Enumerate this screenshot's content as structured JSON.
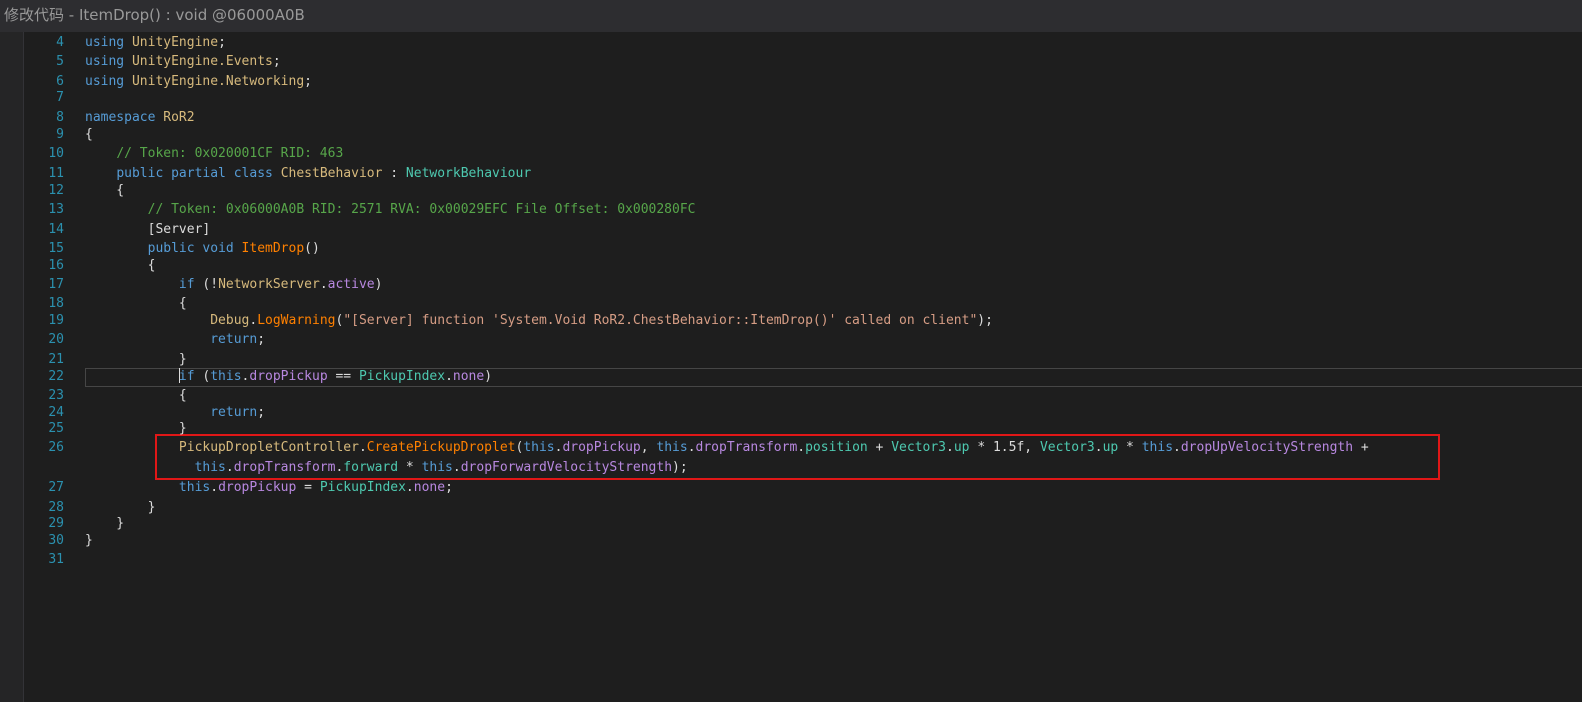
{
  "window": {
    "title": "修改代码 - ItemDrop() : void @06000A0B"
  },
  "colors": {
    "keyword": "#569cd6",
    "namespace": "#d7ba7d",
    "type": "#4ec9b0",
    "method": "#ff8000",
    "field": "#b888e0",
    "property": "#4ec9b0",
    "comment": "#57a64a",
    "string": "#d69d85",
    "line_number": "#2b91af",
    "plain": "#dcdcdc",
    "title_text": "#999999"
  },
  "code_lines": [
    {
      "num": "4",
      "tokens": [
        {
          "t": "using ",
          "c": "keyword"
        },
        {
          "t": "UnityEngine",
          "c": "namespace"
        },
        {
          "t": ";",
          "c": "plain"
        }
      ]
    },
    {
      "num": "5",
      "tokens": [
        {
          "t": "using ",
          "c": "keyword"
        },
        {
          "t": "UnityEngine.Events",
          "c": "namespace"
        },
        {
          "t": ";",
          "c": "plain"
        }
      ]
    },
    {
      "num": "6",
      "tokens": [
        {
          "t": "using ",
          "c": "keyword"
        },
        {
          "t": "UnityEngine.Networking",
          "c": "namespace"
        },
        {
          "t": ";",
          "c": "plain"
        }
      ]
    },
    {
      "num": "7",
      "tokens": []
    },
    {
      "num": "8",
      "tokens": [
        {
          "t": "namespace ",
          "c": "keyword"
        },
        {
          "t": "RoR2",
          "c": "namespace"
        }
      ]
    },
    {
      "num": "9",
      "tokens": [
        {
          "t": "{",
          "c": "plain"
        }
      ]
    },
    {
      "num": "10",
      "tokens": [
        {
          "t": "    ",
          "c": "plain"
        },
        {
          "t": "// Token: 0x020001CF RID: 463",
          "c": "comment"
        }
      ]
    },
    {
      "num": "11",
      "tokens": [
        {
          "t": "    ",
          "c": "plain"
        },
        {
          "t": "public partial class ",
          "c": "keyword"
        },
        {
          "t": "ChestBehavior",
          "c": "namespace"
        },
        {
          "t": " : ",
          "c": "plain"
        },
        {
          "t": "NetworkBehaviour",
          "c": "type"
        }
      ]
    },
    {
      "num": "12",
      "tokens": [
        {
          "t": "    {",
          "c": "plain"
        }
      ]
    },
    {
      "num": "13",
      "tokens": [
        {
          "t": "        ",
          "c": "plain"
        },
        {
          "t": "// Token: 0x06000A0B RID: 2571 RVA: 0x00029EFC File Offset: 0x000280FC",
          "c": "comment"
        }
      ]
    },
    {
      "num": "14",
      "tokens": [
        {
          "t": "        [",
          "c": "plain"
        },
        {
          "t": "Server",
          "c": "plain"
        },
        {
          "t": "]",
          "c": "plain"
        }
      ]
    },
    {
      "num": "15",
      "tokens": [
        {
          "t": "        ",
          "c": "plain"
        },
        {
          "t": "public void ",
          "c": "keyword"
        },
        {
          "t": "ItemDrop",
          "c": "method"
        },
        {
          "t": "()",
          "c": "plain"
        }
      ]
    },
    {
      "num": "16",
      "tokens": [
        {
          "t": "        {",
          "c": "plain"
        }
      ]
    },
    {
      "num": "17",
      "tokens": [
        {
          "t": "            ",
          "c": "plain"
        },
        {
          "t": "if",
          "c": "keyword"
        },
        {
          "t": " (!",
          "c": "plain"
        },
        {
          "t": "NetworkServer",
          "c": "namespace"
        },
        {
          "t": ".",
          "c": "plain"
        },
        {
          "t": "active",
          "c": "field"
        },
        {
          "t": ")",
          "c": "plain"
        }
      ]
    },
    {
      "num": "18",
      "tokens": [
        {
          "t": "            {",
          "c": "plain"
        }
      ]
    },
    {
      "num": "19",
      "tokens": [
        {
          "t": "                ",
          "c": "plain"
        },
        {
          "t": "Debug",
          "c": "namespace"
        },
        {
          "t": ".",
          "c": "plain"
        },
        {
          "t": "LogWarning",
          "c": "method"
        },
        {
          "t": "(",
          "c": "plain"
        },
        {
          "t": "\"[Server] function 'System.Void RoR2.ChestBehavior::ItemDrop()' called on client\"",
          "c": "string"
        },
        {
          "t": ");",
          "c": "plain"
        }
      ]
    },
    {
      "num": "20",
      "tokens": [
        {
          "t": "                ",
          "c": "plain"
        },
        {
          "t": "return",
          "c": "keyword"
        },
        {
          "t": ";",
          "c": "plain"
        }
      ]
    },
    {
      "num": "21",
      "tokens": [
        {
          "t": "            }",
          "c": "plain"
        }
      ]
    },
    {
      "num": "22",
      "tokens": [
        {
          "t": "            ",
          "c": "plain"
        },
        {
          "t": "CARET",
          "c": "caret"
        },
        {
          "t": "if",
          "c": "keyword"
        },
        {
          "t": " (",
          "c": "plain"
        },
        {
          "t": "this",
          "c": "keyword"
        },
        {
          "t": ".",
          "c": "plain"
        },
        {
          "t": "dropPickup",
          "c": "field"
        },
        {
          "t": " == ",
          "c": "plain"
        },
        {
          "t": "PickupIndex",
          "c": "type"
        },
        {
          "t": ".",
          "c": "plain"
        },
        {
          "t": "none",
          "c": "field"
        },
        {
          "t": ")",
          "c": "plain"
        }
      ]
    },
    {
      "num": "23",
      "tokens": [
        {
          "t": "            {",
          "c": "plain"
        }
      ]
    },
    {
      "num": "24",
      "tokens": [
        {
          "t": "                ",
          "c": "plain"
        },
        {
          "t": "return",
          "c": "keyword"
        },
        {
          "t": ";",
          "c": "plain"
        }
      ]
    },
    {
      "num": "25",
      "tokens": [
        {
          "t": "            }",
          "c": "plain"
        }
      ]
    },
    {
      "num": "26",
      "tokens": [
        {
          "t": "            ",
          "c": "plain"
        },
        {
          "t": "PickupDropletController",
          "c": "namespace"
        },
        {
          "t": ".",
          "c": "plain"
        },
        {
          "t": "CreatePickupDroplet",
          "c": "method"
        },
        {
          "t": "(",
          "c": "plain"
        },
        {
          "t": "this",
          "c": "keyword"
        },
        {
          "t": ".",
          "c": "plain"
        },
        {
          "t": "dropPickup",
          "c": "field"
        },
        {
          "t": ", ",
          "c": "plain"
        },
        {
          "t": "this",
          "c": "keyword"
        },
        {
          "t": ".",
          "c": "plain"
        },
        {
          "t": "dropTransform",
          "c": "field"
        },
        {
          "t": ".",
          "c": "plain"
        },
        {
          "t": "position",
          "c": "property"
        },
        {
          "t": " + ",
          "c": "plain"
        },
        {
          "t": "Vector3",
          "c": "type"
        },
        {
          "t": ".",
          "c": "plain"
        },
        {
          "t": "up",
          "c": "property"
        },
        {
          "t": " * 1.5f, ",
          "c": "plain"
        },
        {
          "t": "Vector3",
          "c": "type"
        },
        {
          "t": ".",
          "c": "plain"
        },
        {
          "t": "up",
          "c": "property"
        },
        {
          "t": " * ",
          "c": "plain"
        },
        {
          "t": "this",
          "c": "keyword"
        },
        {
          "t": ".",
          "c": "plain"
        },
        {
          "t": "dropUpVelocityStrength",
          "c": "field"
        },
        {
          "t": " +",
          "c": "plain"
        }
      ]
    },
    {
      "num": "",
      "tokens": [
        {
          "t": "              ",
          "c": "plain"
        },
        {
          "t": "this",
          "c": "keyword"
        },
        {
          "t": ".",
          "c": "plain"
        },
        {
          "t": "dropTransform",
          "c": "field"
        },
        {
          "t": ".",
          "c": "plain"
        },
        {
          "t": "forward",
          "c": "property"
        },
        {
          "t": " * ",
          "c": "plain"
        },
        {
          "t": "this",
          "c": "keyword"
        },
        {
          "t": ".",
          "c": "plain"
        },
        {
          "t": "dropForwardVelocityStrength",
          "c": "field"
        },
        {
          "t": ");",
          "c": "plain"
        }
      ]
    },
    {
      "num": "27",
      "tokens": [
        {
          "t": "            ",
          "c": "plain"
        },
        {
          "t": "this",
          "c": "keyword"
        },
        {
          "t": ".",
          "c": "plain"
        },
        {
          "t": "dropPickup",
          "c": "field"
        },
        {
          "t": " = ",
          "c": "plain"
        },
        {
          "t": "PickupIndex",
          "c": "type"
        },
        {
          "t": ".",
          "c": "plain"
        },
        {
          "t": "none",
          "c": "field"
        },
        {
          "t": ";",
          "c": "plain"
        }
      ]
    },
    {
      "num": "28",
      "tokens": [
        {
          "t": "        }",
          "c": "plain"
        }
      ]
    },
    {
      "num": "29",
      "tokens": [
        {
          "t": "    }",
          "c": "plain"
        }
      ]
    },
    {
      "num": "30",
      "tokens": [
        {
          "t": "}",
          "c": "plain"
        }
      ]
    },
    {
      "num": "31",
      "tokens": []
    }
  ]
}
